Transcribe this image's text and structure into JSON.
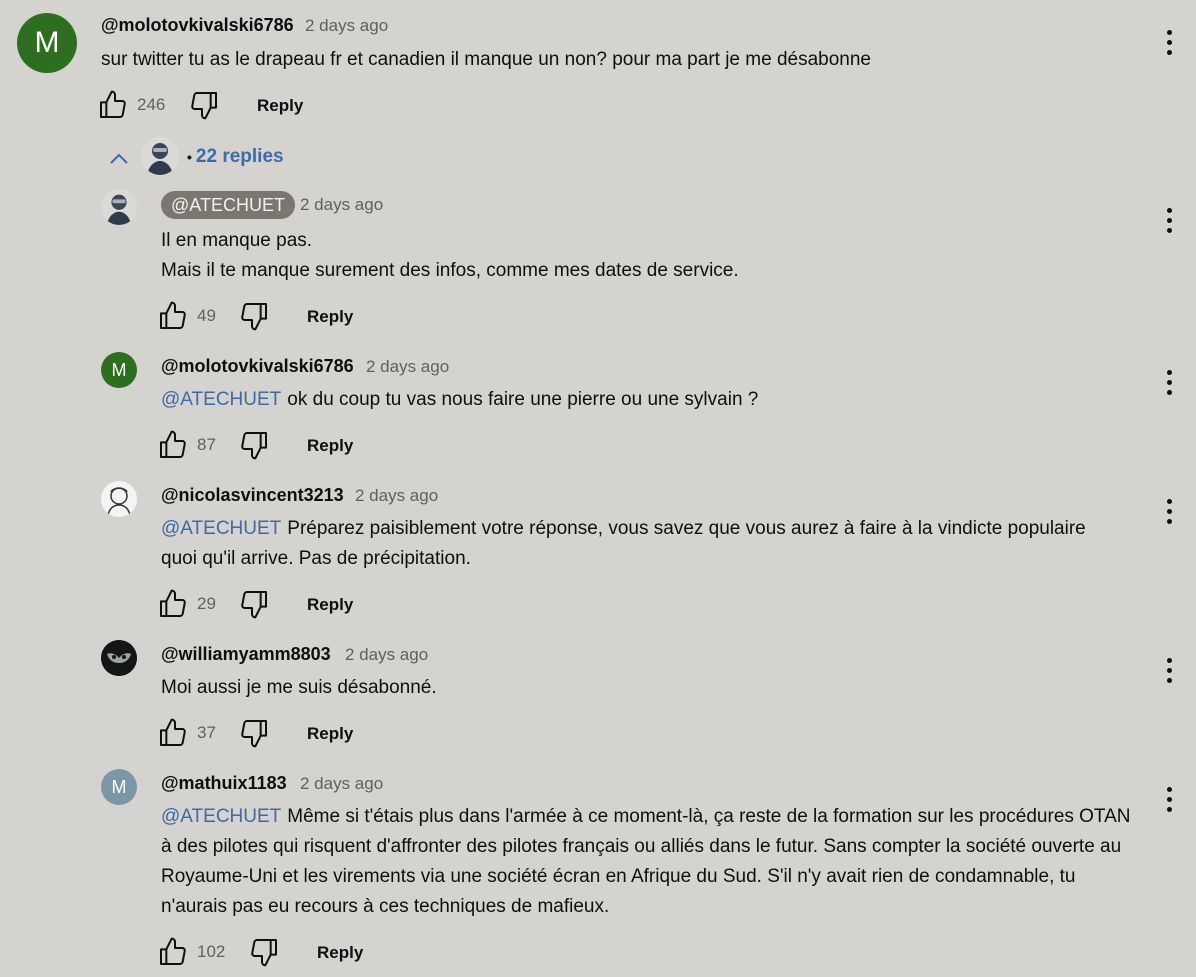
{
  "colors": {
    "background": "#d4d3d0",
    "mention": "#3e6aa8",
    "chip": "#7b7670"
  },
  "top_comment": {
    "avatar_letter": "M",
    "avatar_color": "#2e6e20",
    "author": "@molotovkivalski6786",
    "time": "2 days ago",
    "text": "sur twitter tu as le drapeau fr et canadien il manque un non? pour ma part je me désabonne",
    "likes": "246",
    "reply_label": "Reply"
  },
  "replies_toggle": {
    "bullet": "•",
    "label": "22 replies"
  },
  "replies": [
    {
      "author": "@ATECHUET",
      "author_is_creator": true,
      "time": "2 days ago",
      "lines": [
        "Il en manque pas.",
        "Mais il te manque surement des infos, comme mes dates de service."
      ],
      "likes": "49",
      "reply_label": "Reply"
    },
    {
      "avatar_letter": "M",
      "avatar_color": "#2e6e20",
      "author": "@molotovkivalski6786",
      "time": "2 days ago",
      "mention": "@ATECHUET",
      "text": "ok du coup tu vas nous faire une pierre ou une sylvain ?",
      "likes": "87",
      "reply_label": "Reply"
    },
    {
      "author": "@nicolasvincent3213",
      "time": "2 days ago",
      "mention": "@ATECHUET",
      "text": "Préparez paisiblement votre réponse, vous savez que vous aurez à faire à la vindicte populaire quoi qu'il arrive. Pas de précipitation.",
      "likes": "29",
      "reply_label": "Reply"
    },
    {
      "author": "@williamyamm8803",
      "time": "2 days ago",
      "text": "Moi aussi je me suis désabonné.",
      "likes": "37",
      "reply_label": "Reply"
    },
    {
      "avatar_letter": "M",
      "avatar_color": "#7a97a8",
      "author": "@mathuix1183",
      "time": "2 days ago",
      "mention": "@ATECHUET",
      "text": "Même si t'étais plus dans l'armée à ce moment-là, ça reste de la formation sur les procédures OTAN à des pilotes qui risquent d'affronter des pilotes français ou alliés dans le futur. Sans compter la société ouverte au Royaume-Uni et les virements via une société écran en Afrique du Sud. S'il n'y avait rien de condamnable, tu n'aurais pas eu recours à ces techniques de mafieux.",
      "likes": "102",
      "reply_label": "Reply"
    }
  ]
}
